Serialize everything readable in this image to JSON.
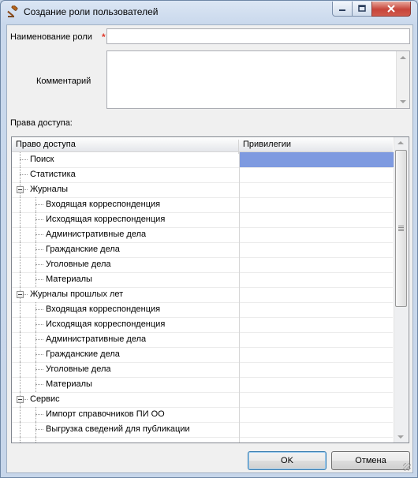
{
  "window": {
    "title": "Создание роли пользователей",
    "controls": {
      "minimize": "minimize",
      "maximize": "maximize",
      "close": "close"
    }
  },
  "form": {
    "name_label": "Наименование роли",
    "required_mark": "*",
    "name_value": "",
    "comment_label": "Комментарий",
    "comment_value": "",
    "rights_label": "Права доступа:"
  },
  "grid": {
    "columns": [
      "Право доступа",
      "Привилегии"
    ],
    "rows": [
      {
        "label": "Поиск",
        "level": 0,
        "group": false,
        "selected": true
      },
      {
        "label": "Статистика",
        "level": 0,
        "group": false,
        "selected": false
      },
      {
        "label": "Журналы",
        "level": 0,
        "group": true,
        "selected": false
      },
      {
        "label": "Входящая корреспонденция",
        "level": 1,
        "group": false,
        "selected": false
      },
      {
        "label": "Исходящая корреспонденция",
        "level": 1,
        "group": false,
        "selected": false
      },
      {
        "label": "Административные дела",
        "level": 1,
        "group": false,
        "selected": false
      },
      {
        "label": "Гражданские дела",
        "level": 1,
        "group": false,
        "selected": false
      },
      {
        "label": "Уголовные дела",
        "level": 1,
        "group": false,
        "selected": false
      },
      {
        "label": "Материалы",
        "level": 1,
        "group": false,
        "selected": false
      },
      {
        "label": "Журналы прошлых лет",
        "level": 0,
        "group": true,
        "selected": false
      },
      {
        "label": "Входящая корреспонденция",
        "level": 1,
        "group": false,
        "selected": false
      },
      {
        "label": "Исходящая корреспонденция",
        "level": 1,
        "group": false,
        "selected": false
      },
      {
        "label": "Административные дела",
        "level": 1,
        "group": false,
        "selected": false
      },
      {
        "label": "Гражданские дела",
        "level": 1,
        "group": false,
        "selected": false
      },
      {
        "label": "Уголовные дела",
        "level": 1,
        "group": false,
        "selected": false
      },
      {
        "label": "Материалы",
        "level": 1,
        "group": false,
        "selected": false
      },
      {
        "label": "Сервис",
        "level": 0,
        "group": true,
        "selected": false
      },
      {
        "label": "Импорт справочников ПИ ОО",
        "level": 1,
        "group": false,
        "selected": false
      },
      {
        "label": "Выгрузка сведений для публикации",
        "level": 1,
        "group": false,
        "selected": false
      },
      {
        "label": "",
        "level": 1,
        "group": false,
        "selected": false
      }
    ]
  },
  "buttons": {
    "ok": "OK",
    "cancel": "Отмена"
  },
  "icons": {
    "title": "gavel-icon"
  },
  "colors": {
    "selection": "#7e9ae0",
    "required": "#e03b2d",
    "close_button": "#c7453a"
  }
}
